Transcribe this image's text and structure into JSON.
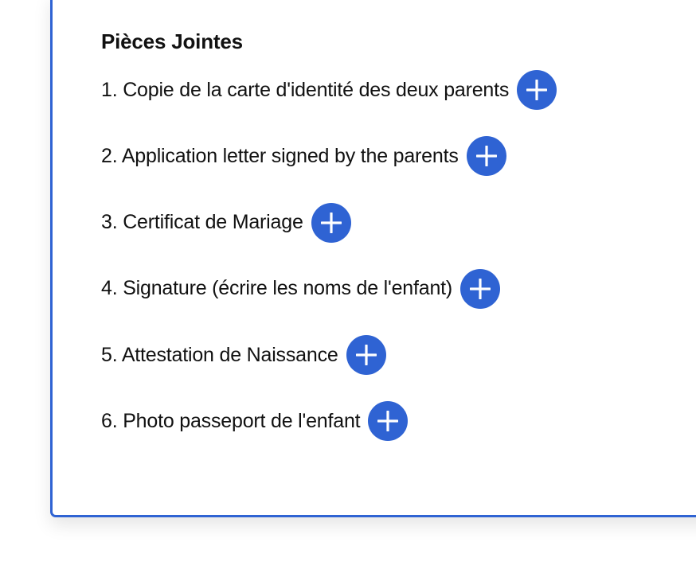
{
  "attachments": {
    "title": "Pièces Jointes",
    "items": [
      {
        "label": "1. Copie de la carte d'identité des deux parents",
        "action_icon": "plus-circle-icon"
      },
      {
        "label": "2. Application letter signed by the parents",
        "action_icon": "plus-circle-icon"
      },
      {
        "label": "3. Certificat de Mariage",
        "action_icon": "plus-circle-icon"
      },
      {
        "label": "4. Signature (écrire les noms de l'enfant)",
        "action_icon": "plus-circle-icon"
      },
      {
        "label": "5. Attestation de Naissance",
        "action_icon": "plus-circle-icon"
      },
      {
        "label": "6. Photo passeport de l'enfant",
        "action_icon": "plus-circle-icon"
      }
    ]
  },
  "colors": {
    "accent": "#2f63d3",
    "text": "#111111",
    "background": "#ffffff"
  }
}
